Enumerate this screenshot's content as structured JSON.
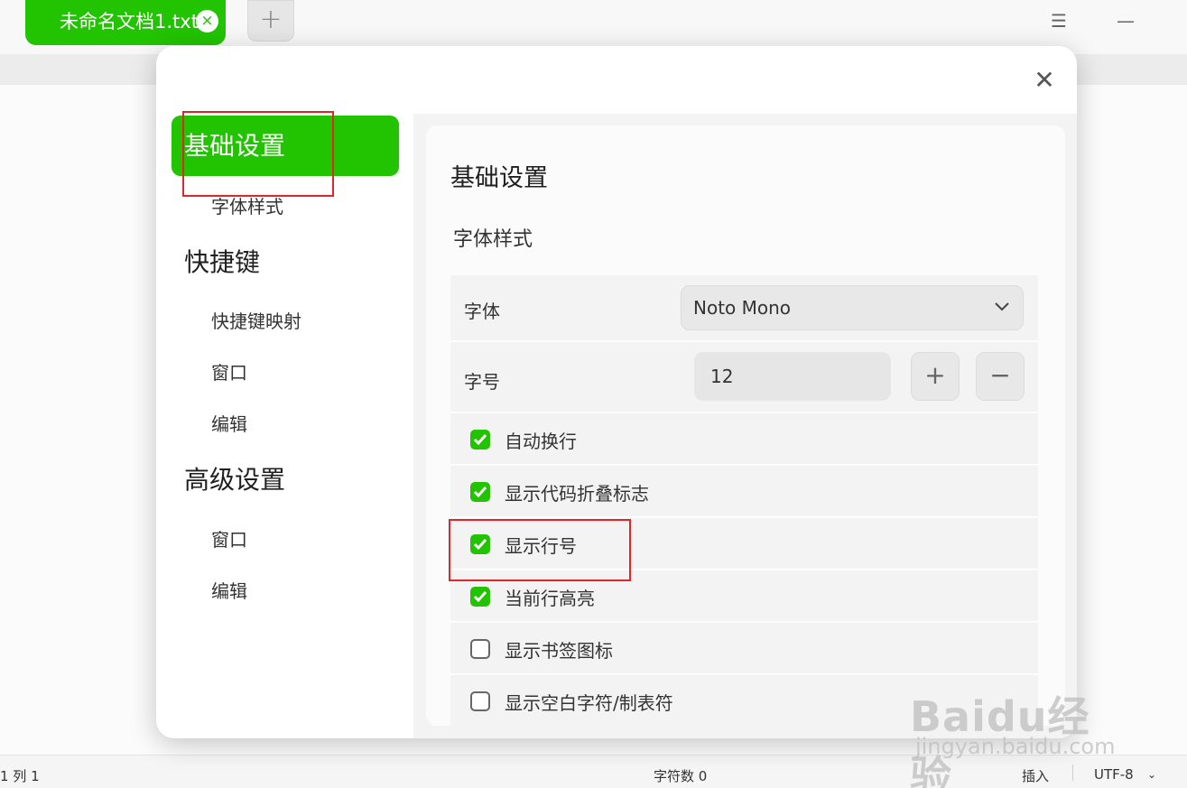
{
  "window": {
    "tab_title": "未命名文档1.txt",
    "tab_close_icon": "×",
    "new_tab_icon": "+",
    "menu_icon": "☰",
    "minimize_icon": "—"
  },
  "statusbar": {
    "position": "1 列 1",
    "char_count": "字符数 0",
    "insert_mode": "插入",
    "encoding": "UTF-8",
    "encoding_chevron": "⌄"
  },
  "dialog": {
    "close_icon": "✕",
    "sidebar": {
      "groups": [
        {
          "label": "基础设置",
          "active": true,
          "items": [
            "字体样式"
          ]
        },
        {
          "label": "快捷键",
          "active": false,
          "items": [
            "快捷键映射",
            "窗口",
            "编辑"
          ]
        },
        {
          "label": "高级设置",
          "active": false,
          "items": [
            "窗口",
            "编辑"
          ]
        }
      ]
    },
    "content": {
      "title": "基础设置",
      "section": "字体样式",
      "font": {
        "label": "字体",
        "value": "Noto Mono"
      },
      "font_size": {
        "label": "字号",
        "value": "12",
        "plus": "+",
        "minus": "−"
      },
      "options": [
        {
          "label": "自动换行",
          "checked": true
        },
        {
          "label": "显示代码折叠标志",
          "checked": true
        },
        {
          "label": "显示行号",
          "checked": true
        },
        {
          "label": "当前行高亮",
          "checked": true
        },
        {
          "label": "显示书签图标",
          "checked": false
        },
        {
          "label": "显示空白字符/制表符",
          "checked": false
        }
      ]
    }
  },
  "watermark": {
    "main": "Baidu经验",
    "sub": "jingyan.baidu.com"
  },
  "colors": {
    "accent": "#22c300",
    "highlight_box": "#e0262a"
  }
}
